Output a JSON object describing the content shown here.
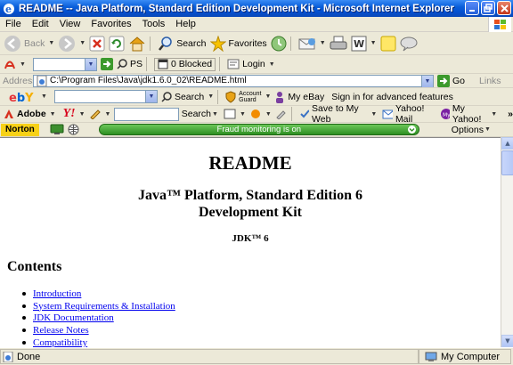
{
  "window": {
    "title": "README -- Java Platform, Standard Edition Development Kit - Microsoft Internet Explorer"
  },
  "menu": [
    "File",
    "Edit",
    "View",
    "Favorites",
    "Tools",
    "Help"
  ],
  "standard_toolbar": {
    "back": "Back",
    "search": "Search",
    "favorites": "Favorites"
  },
  "toolbar1": {
    "ps": "PS",
    "blocked": "0 Blocked",
    "login": "Login"
  },
  "address": {
    "label": "Address",
    "url": "C:\\Program Files\\Java\\jdk1.6.0_02\\README.html",
    "go": "Go",
    "links": "Links"
  },
  "ebay": {
    "logo": "ebY",
    "search": "Search",
    "account_guard_1": "Account",
    "account_guard_2": "Guard",
    "my_ebay": "My eBay",
    "sign_in": "Sign in for advanced features"
  },
  "yahoo": {
    "adobe": "Adobe",
    "yahoo_logo": "Y!",
    "search": "Search",
    "save": "Save to My Web",
    "mail": "Yahoo! Mail",
    "my_yahoo": "My Yahoo!",
    "more": "»"
  },
  "norton": {
    "logo": "Norton",
    "status": "Fraud monitoring is on",
    "options": "Options"
  },
  "page": {
    "title": "README",
    "subtitle_line1": "Java™ Platform, Standard Edition 6",
    "subtitle_line2": "Development Kit",
    "jdk": "JDK™ 6",
    "contents_heading": "Contents",
    "toc": [
      "Introduction",
      "System Requirements & Installation",
      "JDK Documentation",
      "Release Notes",
      "Compatibility"
    ]
  },
  "statusbar": {
    "left": "Done",
    "zone": "My Computer"
  },
  "colors": {
    "link": "#0000EE",
    "titlebar": "#0A5FDA",
    "norton_green": "#3DAA2C"
  }
}
